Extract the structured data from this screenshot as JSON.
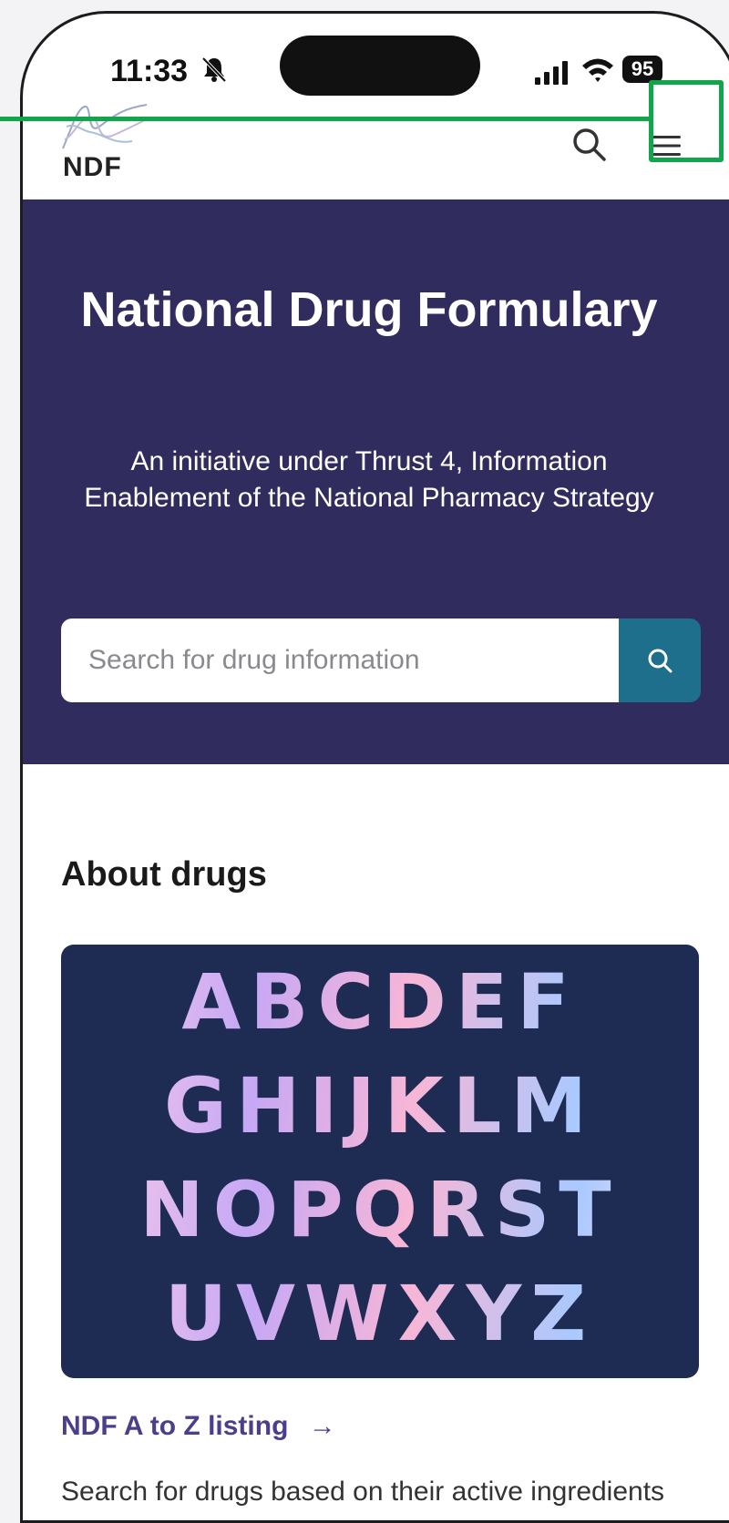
{
  "status_bar": {
    "time": "11:33",
    "battery": "95"
  },
  "header": {
    "logo_text": "NDF"
  },
  "hero": {
    "title": "National Drug Formulary",
    "subtitle": "An initiative under Thrust 4, Information Enablement of the National Pharmacy Strategy",
    "search_placeholder": "Search for drug information"
  },
  "about": {
    "title": "About drugs",
    "alphabet_rows": [
      "ABCDEF",
      "GHIJKLM",
      "NOPQRST",
      "UVWXYZ"
    ],
    "link_label": "NDF A to Z listing",
    "link_arrow": "→",
    "description": "Search for drugs based on their active ingredients"
  },
  "colors": {
    "hero_bg": "#312c5e",
    "search_button": "#1d6f8c",
    "card_bg": "#1e2b52",
    "link": "#4a3f8a",
    "highlight": "#12a64c"
  },
  "icons": {
    "header_search": "search-icon",
    "menu": "hamburger-menu-icon",
    "search_submit": "search-icon",
    "status_silent": "bell-slash-icon"
  }
}
